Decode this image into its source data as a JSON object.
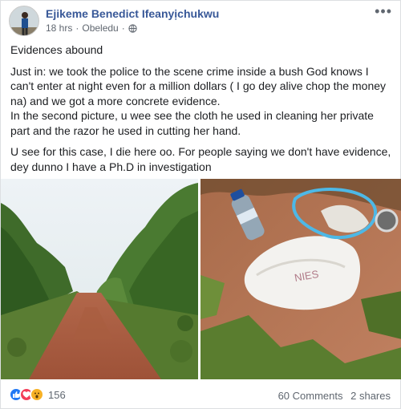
{
  "post": {
    "author": "Ejikeme Benedict Ifeanyịchukwu",
    "time": "18 hrs",
    "separator": "·",
    "location": "Obeledu",
    "location_separator": "·",
    "audience_icon": "globe-icon",
    "more_icon": "more-options-icon"
  },
  "text": {
    "p1": "Evidences abound",
    "p2": "Just in: we took the police to the scene crime inside a bush God knows I can't enter at night even for a million dollars ( I go dey alive chop the money na) and we got a more concrete evidence.",
    "p3": "In the second picture, u wee see the cloth he used in cleaning her private part and the razor he used in cutting her hand.",
    "p4": "U see for this case, I die here oo. For people saying we don't have evidence, dey dunno I have a Ph.D in investigation"
  },
  "photos": {
    "left_icon": "bush-path-photo",
    "right_icon": "cloth-evidence-photo",
    "bag_text": "NIES"
  },
  "footer": {
    "reaction_icons": [
      "like-icon",
      "love-icon",
      "wow-icon"
    ],
    "reaction_count": "156",
    "comments": "60 Comments",
    "shares": "2 shares"
  },
  "colors": {
    "author": "#385898",
    "meta": "#606770",
    "like": "#2078f4",
    "love": "#f33e58",
    "wow": "#f7b125"
  }
}
